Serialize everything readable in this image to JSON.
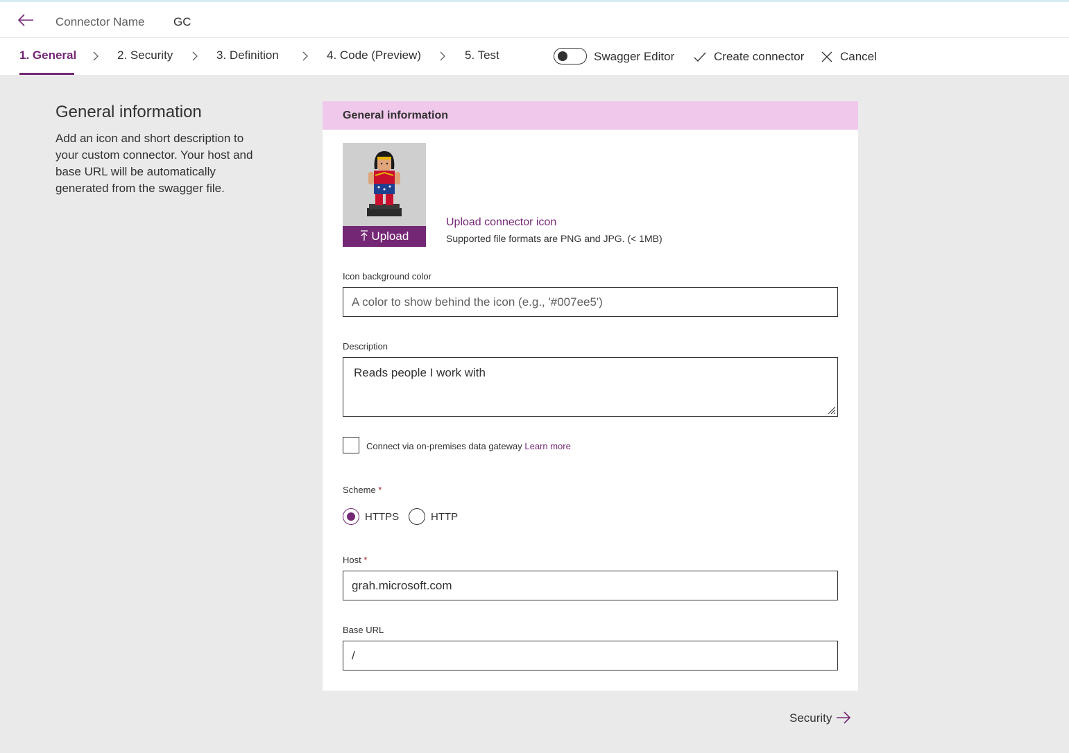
{
  "header": {
    "connector_name_label": "Connector Name",
    "connector_name_value": "GC"
  },
  "tabs": [
    {
      "label": "1. General",
      "active": true
    },
    {
      "label": "2. Security",
      "active": false
    },
    {
      "label": "3. Definition",
      "active": false
    },
    {
      "label": "4. Code (Preview)",
      "active": false
    },
    {
      "label": "5. Test",
      "active": false
    }
  ],
  "commands": {
    "swagger_editor": "Swagger Editor",
    "swagger_editor_on": false,
    "create_connector": "Create connector",
    "cancel": "Cancel"
  },
  "left_panel": {
    "title": "General information",
    "description": "Add an icon and short description to your custom connector. Your host and base URL will be automatically generated from the swagger file."
  },
  "card": {
    "header": "General information",
    "upload_button": "Upload",
    "upload_link": "Upload connector icon",
    "upload_note": "Supported file formats are PNG and JPG. (< 1MB)",
    "icon_bg_label": "Icon background color",
    "icon_bg_placeholder": "A color to show behind the icon (e.g., '#007ee5')",
    "icon_bg_value": "",
    "description_label": "Description",
    "description_value": "Reads people I work with",
    "gateway_label": "Connect via on-premises data gateway",
    "gateway_link": "Learn more",
    "gateway_checked": false,
    "scheme_label": "Scheme",
    "required_mark": "*",
    "scheme_options": [
      "HTTPS",
      "HTTP"
    ],
    "scheme_selected": "HTTPS",
    "host_label": "Host",
    "host_value": "grah.microsoft.com",
    "base_url_label": "Base URL",
    "base_url_value": "/"
  },
  "footer": {
    "next_label": "Security"
  },
  "colors": {
    "accent": "#742774",
    "card_header_bg": "#f0c8ec",
    "page_bg": "#eaeaea"
  }
}
